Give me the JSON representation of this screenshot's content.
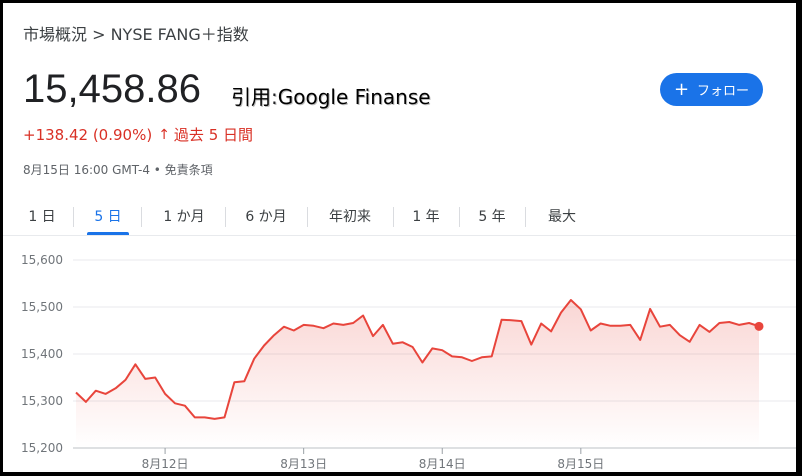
{
  "breadcrumb": "市場概況 > NYSE FANG＋指数",
  "price": "15,458.86",
  "source": {
    "label": "引用",
    "separator": ":",
    "name": "Google Finanse"
  },
  "follow_button": {
    "icon": "plus-icon",
    "label": "フォロー"
  },
  "change": {
    "value": "+138.42 (0.90%)",
    "arrow": "↑",
    "period": "過去 5 日間"
  },
  "timestamp": "8月15日 16:00 GMT-4 • 免責条項",
  "tabs": [
    "1 日",
    "5 日",
    "1 か月",
    "6 か月",
    "年初来",
    "1 年",
    "5 年",
    "最大"
  ],
  "active_tab": "5 日",
  "colors": {
    "line": "#e8453c",
    "accent": "#1a73e8",
    "negative": "#d93025"
  },
  "chart_data": {
    "type": "area",
    "ylim": [
      15200,
      15600
    ],
    "yticks": [
      15600,
      15500,
      15400,
      15300,
      15200
    ],
    "ytick_labels": [
      "15,600",
      "15,500",
      "15,400",
      "15,300",
      "15,200"
    ],
    "xtick_labels": [
      "8月12日",
      "8月13日",
      "8月14日",
      "8月15日"
    ],
    "xtick_positions": [
      9,
      23,
      37,
      51
    ],
    "series": [
      {
        "values": [
          15318,
          15298,
          15322,
          15315,
          15327,
          15345,
          15378,
          15347,
          15350,
          15315,
          15295,
          15290,
          15265,
          15265,
          15262,
          15265,
          15340,
          15342,
          15390,
          15418,
          15440,
          15458,
          15450,
          15462,
          15460,
          15455,
          15465,
          15462,
          15466,
          15482,
          15438,
          15462,
          15422,
          15425,
          15415,
          15382,
          15412,
          15408,
          15395,
          15393,
          15385,
          15393,
          15395,
          15473,
          15472,
          15470,
          15420,
          15465,
          15448,
          15488,
          15515,
          15495,
          15450,
          15465,
          15460,
          15460,
          15462,
          15430,
          15496,
          15458,
          15462,
          15440,
          15426,
          15462,
          15447,
          15466,
          15468,
          15462,
          15466,
          15458.86
        ]
      }
    ],
    "last_point_marker": true
  }
}
